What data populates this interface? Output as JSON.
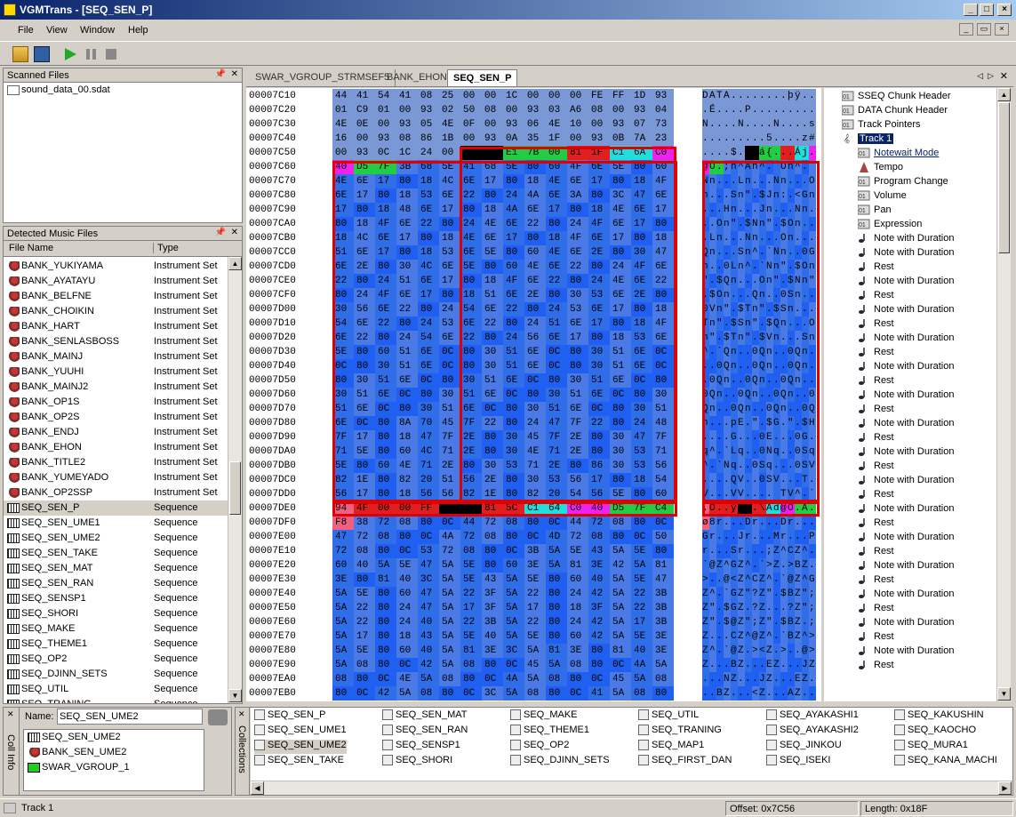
{
  "window": {
    "title": "VGMTrans - [SEQ_SEN_P]"
  },
  "menu": [
    "File",
    "View",
    "Window",
    "Help"
  ],
  "scanned": {
    "title": "Scanned Files",
    "items": [
      "sound_data_00.sdat"
    ]
  },
  "detected": {
    "title": "Detected Music Files",
    "col_name": "File Name",
    "col_type": "Type",
    "selected": "SEQ_SEN_P",
    "items": [
      [
        "BANK_YUKIYAMA",
        "Instrument Set"
      ],
      [
        "BANK_AYATAYU",
        "Instrument Set"
      ],
      [
        "BANK_BELFNE",
        "Instrument Set"
      ],
      [
        "BANK_CHOIKIN",
        "Instrument Set"
      ],
      [
        "BANK_HART",
        "Instrument Set"
      ],
      [
        "BANK_SENLASBOSS",
        "Instrument Set"
      ],
      [
        "BANK_MAINJ",
        "Instrument Set"
      ],
      [
        "BANK_YUUHI",
        "Instrument Set"
      ],
      [
        "BANK_MAINJ2",
        "Instrument Set"
      ],
      [
        "BANK_OP1S",
        "Instrument Set"
      ],
      [
        "BANK_OP2S",
        "Instrument Set"
      ],
      [
        "BANK_ENDJ",
        "Instrument Set"
      ],
      [
        "BANK_EHON",
        "Instrument Set"
      ],
      [
        "BANK_TITLE2",
        "Instrument Set"
      ],
      [
        "BANK_YUMEYADO",
        "Instrument Set"
      ],
      [
        "BANK_OP2SSP",
        "Instrument Set"
      ],
      [
        "SEQ_SEN_P",
        "Sequence"
      ],
      [
        "SEQ_SEN_UME1",
        "Sequence"
      ],
      [
        "SEQ_SEN_UME2",
        "Sequence"
      ],
      [
        "SEQ_SEN_TAKE",
        "Sequence"
      ],
      [
        "SEQ_SEN_MAT",
        "Sequence"
      ],
      [
        "SEQ_SEN_RAN",
        "Sequence"
      ],
      [
        "SEQ_SENSP1",
        "Sequence"
      ],
      [
        "SEQ_SHORI",
        "Sequence"
      ],
      [
        "SEQ_MAKE",
        "Sequence"
      ],
      [
        "SEQ_THEME1",
        "Sequence"
      ],
      [
        "SEQ_OP2",
        "Sequence"
      ],
      [
        "SEQ_DJINN_SETS",
        "Sequence"
      ],
      [
        "SEQ_UTIL",
        "Sequence"
      ],
      [
        "SEQ_TRANING",
        "Sequence"
      ]
    ]
  },
  "tabs": [
    "SWAR_VGROUP_STRMSEF5",
    "BANK_EHON",
    "SEQ_SEN_P"
  ],
  "hex": {
    "rows": [
      [
        "00007C10",
        "44 41 54 41 08 25 00 00 1C 00 00 00 FE FF 1D 93",
        "DATA........þÿ.."
      ],
      [
        "00007C20",
        "01 C9 01 00 93 02 50 08 00 93 03 A6 08 00 93 04",
        ".É....P........."
      ],
      [
        "00007C30",
        "4E 0E 00 93 05 4E 0F 00 93 06 4E 10 00 93 07 73",
        "N....N....N....s"
      ],
      [
        "00007C40",
        "16 00 93 08 86 1B 00 93 0A 35 1F 00 93 0B 7A 23",
        ".........5....z#"
      ],
      [
        "00007C50",
        "00 93 0C 1C 24 00 C7 00 E1 7B 00 81 1F C1 6A C0",
        "....$.Ç.á{...Áj"
      ],
      [
        "00007C60",
        "40 D5 7F 3B 68 5E 41 68 5E 80 60 4F 6E 5E 80 60",
        "@Õ.;h^Ah^.`On^.`"
      ],
      [
        "00007C70",
        "4E 6E 17 80 18 4C 6E 17 80 18 4E 6E 17 80 18 4F",
        "Nn...Ln...Nn...O"
      ],
      [
        "00007C80",
        "6E 17 80 18 53 6E 22 80 24 4A 6E 3A 80 3C 47 6E",
        "n...Sn\".$Jn:.<Gn"
      ],
      [
        "00007C90",
        "17 80 18 48 6E 17 80 18 4A 6E 17 80 18 4E 6E 17",
        "...Hn...Jn...Nn."
      ],
      [
        "00007CA0",
        "80 18 4F 6E 22 80 24 4E 6E 22 80 24 4F 6E 17 80",
        "..On\".$Nn\".$On.."
      ],
      [
        "00007CB0",
        "18 4C 6E 17 80 18 4E 6E 17 80 18 4F 6E 17 80 18",
        ".Ln...Nn...On..."
      ],
      [
        "00007CC0",
        "51 6E 17 80 18 53 6E 5E 80 60 4E 6E 2E 80 30 47",
        "Qn...Sn^.`Nn..0G"
      ],
      [
        "00007CD0",
        "6E 2E 80 30 4C 6E 5E 80 60 4E 6E 22 80 24 4F 6E",
        "n..0Ln^.`Nn\".$On"
      ],
      [
        "00007CE0",
        "22 80 24 51 6E 17 80 18 4F 6E 22 80 24 4E 6E 22",
        "\".$Qn...On\".$Nn\""
      ],
      [
        "00007CF0",
        "80 24 4F 6E 17 80 18 51 6E 2E 80 30 53 6E 2E 80",
        ".$On...Qn..0Sn.."
      ],
      [
        "00007D00",
        "30 56 6E 22 80 24 54 6E 22 80 24 53 6E 17 80 18",
        "0Vn\".$Tn\".$Sn..."
      ],
      [
        "00007D10",
        "54 6E 22 80 24 53 6E 22 80 24 51 6E 17 80 18 4F",
        "Tn\".$Sn\".$Qn...O"
      ],
      [
        "00007D20",
        "6E 22 80 24 54 6E 22 80 24 56 6E 17 80 18 53 6E",
        "n\".$Tn\".$Vn...Sn"
      ],
      [
        "00007D30",
        "5E 80 60 51 6E 0C 80 30 51 6E 0C 80 30 51 6E 0C",
        "^.`Qn..0Qn..0Qn."
      ],
      [
        "00007D40",
        "0C 80 30 51 6E 0C 80 30 51 6E 0C 80 30 51 6E 0C",
        "..0Qn..0Qn..0Qn."
      ],
      [
        "00007D50",
        "80 30 51 6E 0C 80 30 51 6E 0C 80 30 51 6E 0C 80",
        ".0Qn..0Qn..0Qn.."
      ],
      [
        "00007D60",
        "30 51 6E 0C 80 30 51 6E 0C 80 30 51 6E 0C 80 30",
        "0Qn..0Qn..0Qn..0"
      ],
      [
        "00007D70",
        "51 6E 0C 80 30 51 6E 0C 80 30 51 6E 0C 80 30 51",
        "Qn..0Qn..0Qn..0Q"
      ],
      [
        "00007D80",
        "6E 0C 80 8A 70 45 7F 22 80 24 47 7F 22 80 24 48",
        "n...pE.\".$G.\".$H"
      ],
      [
        "00007D90",
        "7F 17 80 18 47 7F 2E 80 30 45 7F 2E 80 30 47 7F",
        "....G...0E...0G."
      ],
      [
        "00007DA0",
        "71 5E 80 60 4C 71 2E 80 30 4E 71 2E 80 30 53 71",
        "q^.`Lq..0Nq..0Sq"
      ],
      [
        "00007DB0",
        "5E 80 60 4E 71 2E 80 30 53 71 2E 80 86 30 53 56",
        "^.`Nq..0Sq...0SV"
      ],
      [
        "00007DC0",
        "82 1E 80 82 20 51 56 2E 80 30 53 56 17 80 18 54",
        "....QV..0SV...T"
      ],
      [
        "00007DD0",
        "56 17 80 18 56 56 82 1E 80 82 20 54 56 5E 80 60",
        "V...VV.... TV^.`"
      ],
      [
        "00007DE0",
        "94 4F 00 00 FF C7 00 81 5C C1 64 C0 40 D5 7F C4",
        ".O..ÿÇ..\\Ád@Õ.Ä"
      ],
      [
        "00007DF0",
        "F8 38 72 08 80 0C 44 72 08 80 0C 44 72 08 80 0C",
        "ø8r...Dr...Dr..."
      ],
      [
        "00007E00",
        "47 72 08 80 0C 4A 72 08 80 0C 4D 72 08 80 0C 50",
        "Gr...Jr...Mr...P"
      ],
      [
        "00007E10",
        "72 08 80 0C 53 72 08 80 0C 3B 5A 5E 43 5A 5E 80",
        "r...Sr...;Z^CZ^."
      ],
      [
        "00007E20",
        "60 40 5A 5E 47 5A 5E 80 60 3E 5A 81 3E 42 5A 81",
        "`@Z^GZ^.`>Z.>BZ."
      ],
      [
        "00007E30",
        "3E 80 81 40 3C 5A 5E 43 5A 5E 80 60 40 5A 5E 47",
        ">..@<Z^CZ^.`@Z^G"
      ],
      [
        "00007E40",
        "5A 5E 80 60 47 5A 22 3F 5A 22 80 24 42 5A 22 3B",
        "Z^.`GZ\"?Z\".$BZ\";"
      ],
      [
        "00007E50",
        "5A 22 80 24 47 5A 17 3F 5A 17 80 18 3F 5A 22 3B",
        "Z\".$GZ.?Z...?Z\";"
      ],
      [
        "00007E60",
        "5A 22 80 24 40 5A 22 3B 5A 22 80 24 42 5A 17 3B",
        "Z\".$@Z\";Z\".$BZ.;"
      ],
      [
        "00007E70",
        "5A 17 80 18 43 5A 5E 40 5A 5E 80 60 42 5A 5E 3E",
        "Z...CZ^@Z^.`BZ^>"
      ],
      [
        "00007E80",
        "5A 5E 80 60 40 5A 81 3E 3C 5A 81 3E 80 81 40 3E",
        "Z^.`@Z.><Z.>..@>"
      ],
      [
        "00007E90",
        "5A 08 80 0C 42 5A 08 80 0C 45 5A 08 80 0C 4A 5A",
        "Z...BZ...EZ...JZ"
      ],
      [
        "00007EA0",
        "08 80 0C 4E 5A 08 80 0C 4A 5A 08 80 0C 45 5A 08",
        "...NZ...JZ...EZ."
      ],
      [
        "00007EB0",
        "80 0C 42 5A 08 80 0C 3C 5A 08 80 0C 41 5A 08 80",
        "..BZ...<Z...AZ.."
      ]
    ]
  },
  "colors": {
    "gray": "#7a97d6",
    "blue": "#2f6ee8",
    "dark": "#4a7ae6",
    "note": "#2060f0",
    "black": "#000000",
    "red": "#e02020",
    "green": "#22cc44",
    "cyan": "#22dddd",
    "magenta": "#ee22ee",
    "pink": "#f06080",
    "accent": "#0a246a"
  },
  "tree": {
    "items": [
      [
        "SSEQ Chunk Header",
        "hdr",
        0
      ],
      [
        "DATA Chunk Header",
        "hdr",
        0
      ],
      [
        "Track Pointers",
        "hdr",
        0
      ],
      [
        "Track 1",
        "track",
        0
      ],
      [
        "Notewait Mode",
        "hdr",
        1
      ],
      [
        "Tempo",
        "tempo",
        1
      ],
      [
        "Program Change",
        "hdr",
        1
      ],
      [
        "Volume",
        "hdr",
        1
      ],
      [
        "Pan",
        "hdr",
        1
      ],
      [
        "Expression",
        "hdr",
        1
      ],
      [
        "Note with Duration",
        "note",
        1
      ],
      [
        "Note with Duration",
        "note",
        1
      ],
      [
        "Rest",
        "rest",
        1
      ],
      [
        "Note with Duration",
        "note",
        1
      ],
      [
        "Rest",
        "rest",
        1
      ],
      [
        "Note with Duration",
        "note",
        1
      ],
      [
        "Rest",
        "rest",
        1
      ],
      [
        "Note with Duration",
        "note",
        1
      ],
      [
        "Rest",
        "rest",
        1
      ],
      [
        "Note with Duration",
        "note",
        1
      ],
      [
        "Rest",
        "rest",
        1
      ],
      [
        "Note with Duration",
        "note",
        1
      ],
      [
        "Rest",
        "rest",
        1
      ],
      [
        "Note with Duration",
        "note",
        1
      ],
      [
        "Rest",
        "rest",
        1
      ],
      [
        "Note with Duration",
        "note",
        1
      ],
      [
        "Rest",
        "rest",
        1
      ],
      [
        "Note with Duration",
        "note",
        1
      ],
      [
        "Rest",
        "rest",
        1
      ],
      [
        "Note with Duration",
        "note",
        1
      ],
      [
        "Rest",
        "rest",
        1
      ],
      [
        "Note with Duration",
        "note",
        1
      ],
      [
        "Rest",
        "rest",
        1
      ],
      [
        "Note with Duration",
        "note",
        1
      ],
      [
        "Rest",
        "rest",
        1
      ],
      [
        "Note with Duration",
        "note",
        1
      ],
      [
        "Rest",
        "rest",
        1
      ],
      [
        "Note with Duration",
        "note",
        1
      ],
      [
        "Rest",
        "rest",
        1
      ],
      [
        "Note with Duration",
        "note",
        1
      ],
      [
        "Rest",
        "rest",
        1
      ]
    ]
  },
  "cellinfo": {
    "side_label": "Coll Info",
    "name_label": "Name:",
    "name_value": "SEQ_SEN_UME2",
    "items": [
      "SEQ_SEN_UME2",
      "BANK_SEN_UME2",
      "SWAR_VGROUP_1"
    ]
  },
  "collections": {
    "side_label": "Collections",
    "items": [
      "SEQ_SEN_P",
      "SEQ_SEN_UME1",
      "SEQ_SEN_UME2",
      "SEQ_SEN_TAKE",
      "SEQ_SEN_MAT",
      "SEQ_SEN_RAN",
      "SEQ_SENSP1",
      "SEQ_SHORI",
      "SEQ_MAKE",
      "SEQ_THEME1",
      "SEQ_OP2",
      "SEQ_DJINN_SETS",
      "SEQ_UTIL",
      "SEQ_TRANING",
      "SEQ_MAP1",
      "SEQ_FIRST_DAN",
      "SEQ_AYAKASHI1",
      "SEQ_AYAKASHI2",
      "SEQ_JINKOU",
      "SEQ_ISEKI",
      "SEQ_KAKUSHIN",
      "SEQ_KAOCHO",
      "SEQ_MURA1",
      "SEQ_KANA_MACHI"
    ]
  },
  "status": {
    "left": "Track 1",
    "offset": "Offset: 0x7C56",
    "length": "Length: 0x18F"
  }
}
